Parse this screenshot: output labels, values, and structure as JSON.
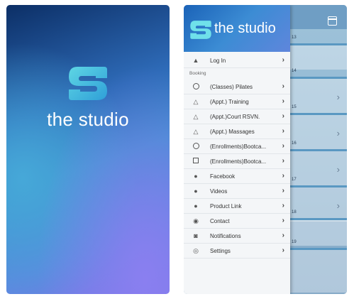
{
  "splash": {
    "title": "the studio"
  },
  "menu_screen": {
    "header": {
      "title": "the studio"
    },
    "login": {
      "label": "Log In",
      "icon": "warning-icon"
    },
    "section_label": "Booking",
    "items": [
      {
        "label": "(Classes) Pilates",
        "icon": "circle-icon"
      },
      {
        "label": "(Appt.) Training",
        "icon": "triangle-icon"
      },
      {
        "label": "(Appt.)Court RSVN.",
        "icon": "triangle-icon"
      },
      {
        "label": "(Appt.) Massages",
        "icon": "triangle-icon"
      },
      {
        "label": "(Enrollments)Bootca...",
        "icon": "circle-icon"
      },
      {
        "label": "(Enrollments)Bootca...",
        "icon": "square-icon"
      },
      {
        "label": "Facebook",
        "icon": "globe-icon"
      },
      {
        "label": "Videos",
        "icon": "globe-icon"
      },
      {
        "label": "Product Link",
        "icon": "globe-icon"
      },
      {
        "label": "Contact",
        "icon": "location-pin-icon"
      },
      {
        "label": "Notifications",
        "icon": "chat-icon"
      },
      {
        "label": "Settings",
        "icon": "gear-icon"
      }
    ],
    "calendar_numbers": [
      "13",
      "14",
      "15",
      "16",
      "17",
      "18",
      "19"
    ]
  },
  "colors": {
    "accent": "#3c8cd4",
    "logo_gradient": [
      "#56d2e0",
      "#2f9fd8"
    ]
  }
}
